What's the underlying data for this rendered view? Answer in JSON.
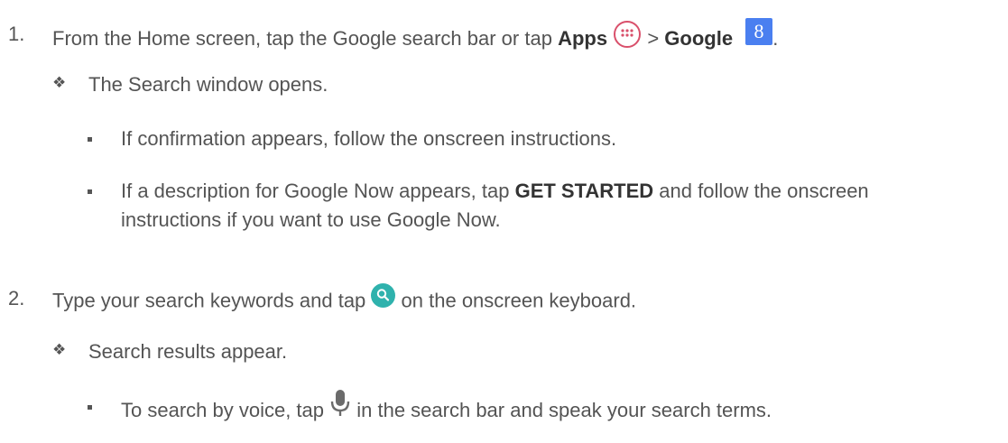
{
  "steps": [
    {
      "number": "1.",
      "text_a": "From the Home screen, tap the Google search bar or tap ",
      "bold_apps": "Apps",
      "text_b": " > ",
      "bold_google": "Google",
      "text_end": ".",
      "apps_icon": "apps-circle-icon",
      "google_icon": "google-g-icon",
      "result": "The Search window opens.",
      "subitems": [
        {
          "text": "If confirmation appears, follow the onscreen instructions."
        },
        {
          "text_a": "If a description for Google Now appears, tap ",
          "bold": "GET STARTED",
          "text_b": " and follow the onscreen",
          "line2": "instructions if you want to use Google Now."
        }
      ]
    },
    {
      "number": "2.",
      "text_a": "Type your search keywords and tap ",
      "text_b": " on the onscreen keyboard.",
      "search_icon": "search-key-icon",
      "result": "Search results appear.",
      "subitems": [
        {
          "text_a": "To search by voice, tap ",
          "text_b": " in the search bar and speak your search terms.",
          "icon": "microphone-icon"
        }
      ]
    }
  ],
  "colors": {
    "text": "#545454",
    "apps_icon": "#d9506b",
    "google_icon": "#4a7ff0",
    "search_icon": "#2fb2ad",
    "mic_icon": "#6b6b6b"
  }
}
